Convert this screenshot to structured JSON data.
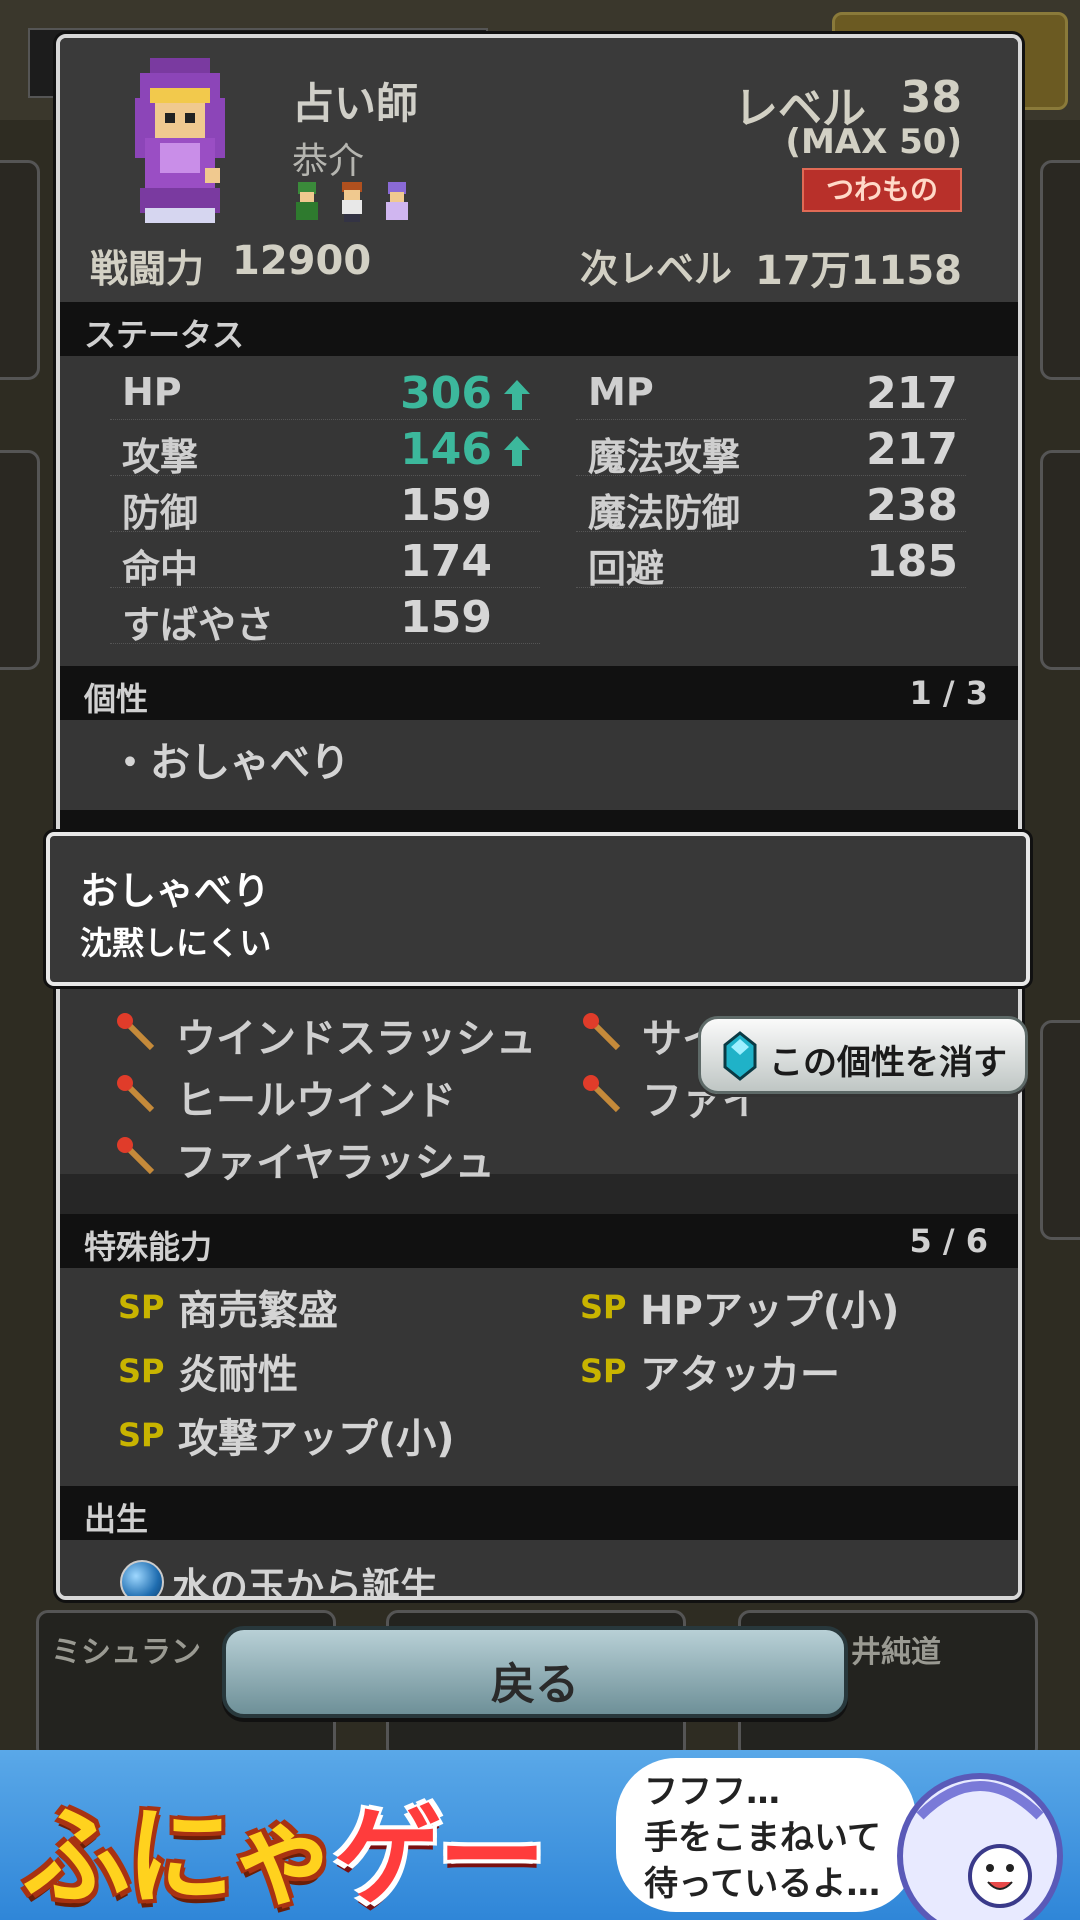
{
  "background": {
    "top_button_label": "ミシュラン",
    "names": [
      "ミシュラン",
      "井純道"
    ]
  },
  "character": {
    "job": "占い師",
    "name": "恭介",
    "level_label": "レベル",
    "level": "38",
    "level_max": "(MAX 50)",
    "rank_badge": "つわもの",
    "power_label": "戦闘力",
    "power": "12900",
    "next_level_label": "次レベル",
    "next_level": "17万1158"
  },
  "status": {
    "title": "ステータス",
    "left": [
      {
        "label": "HP",
        "value": "306",
        "up": true
      },
      {
        "label": "攻撃",
        "value": "146",
        "up": true
      },
      {
        "label": "防御",
        "value": "159",
        "up": false
      },
      {
        "label": "命中",
        "value": "174",
        "up": false
      },
      {
        "label": "すばやさ",
        "value": "159",
        "up": false
      }
    ],
    "right": [
      {
        "label": "MP",
        "value": "217"
      },
      {
        "label": "魔法攻撃",
        "value": "217"
      },
      {
        "label": "魔法防御",
        "value": "238"
      },
      {
        "label": "回避",
        "value": "185"
      }
    ]
  },
  "traits": {
    "title": "個性",
    "count": "1 / 3",
    "items": [
      "・おしゃべり"
    ]
  },
  "skills": {
    "items": [
      "ウインドスラッシュ",
      "サイ",
      "ヒールウインド",
      "ファイ",
      "ファイヤラッシュ"
    ]
  },
  "abilities": {
    "title": "特殊能力",
    "count": "5 / 6",
    "sp_label": "SP",
    "items": [
      "商売繁盛",
      "HPアップ(小)",
      "炎耐性",
      "アタッカー",
      "攻撃アップ(小)"
    ]
  },
  "origin": {
    "title": "出生",
    "text": "水の玉から誕生"
  },
  "popup": {
    "title": "おしゃべり",
    "description": "沈黙しにくい"
  },
  "remove_button": "この個性を消す",
  "back_button": "戻る",
  "ad": {
    "logo_part1": "ふにゃ",
    "logo_part2": "ゲー",
    "lines": [
      "フフフ…",
      "手をこまねいて",
      "待っているよ…"
    ]
  }
}
